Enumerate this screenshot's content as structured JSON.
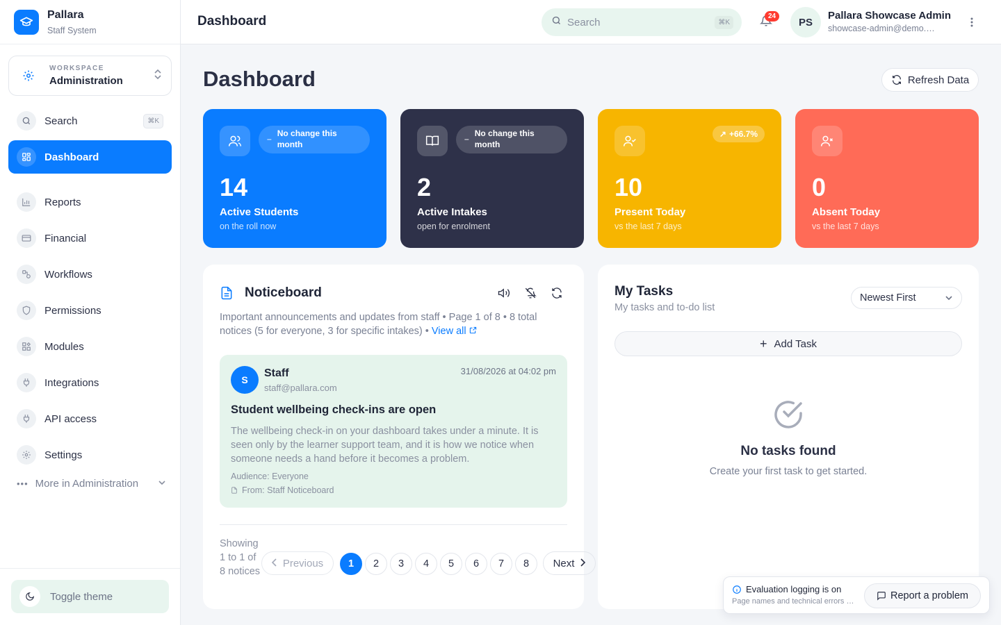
{
  "brand": {
    "name": "Pallara",
    "subtitle": "Staff System",
    "logo_icon": "graduation-cap-icon"
  },
  "workspace": {
    "label": "WORKSPACE",
    "value": "Administration"
  },
  "sidebar": {
    "search_label": "Search",
    "search_shortcut": "⌘K",
    "items": [
      {
        "label": "Dashboard",
        "icon": "grid-icon",
        "active": true
      },
      {
        "label": "Reports",
        "icon": "bar-chart-icon"
      },
      {
        "label": "Financial",
        "icon": "credit-card-icon"
      },
      {
        "label": "Workflows",
        "icon": "workflow-icon"
      },
      {
        "label": "Permissions",
        "icon": "shield-icon"
      },
      {
        "label": "Modules",
        "icon": "modules-icon"
      },
      {
        "label": "Integrations",
        "icon": "plug-icon"
      },
      {
        "label": "API access",
        "icon": "plug-icon"
      },
      {
        "label": "Settings",
        "icon": "gear-icon"
      }
    ],
    "more_label": "More in Administration",
    "toggle_theme": "Toggle theme"
  },
  "topbar": {
    "title": "Dashboard",
    "search_placeholder": "Search",
    "search_shortcut": "⌘K",
    "notifications_count": "24",
    "user": {
      "initials": "PS",
      "name": "Pallara Showcase Admin",
      "email": "showcase-admin@demo.pallara.com"
    }
  },
  "page": {
    "title": "Dashboard",
    "refresh_label": "Refresh Data"
  },
  "stats": [
    {
      "value": "14",
      "label": "Active Students",
      "sub": "on the roll now",
      "pill": "No change this month",
      "color": "#0a7cff",
      "icon": "users-icon"
    },
    {
      "value": "2",
      "label": "Active Intakes",
      "sub": "open for enrolment",
      "pill": "No change this month",
      "color": "#2e3149",
      "icon": "book-icon"
    },
    {
      "value": "10",
      "label": "Present Today",
      "sub": "vs the last 7 days",
      "pill": "+66.7%",
      "color": "#f7b500",
      "icon": "user-check-icon"
    },
    {
      "value": "0",
      "label": "Absent Today",
      "sub": "vs the last 7 days",
      "pill": "",
      "color": "#ff6b57",
      "icon": "user-x-icon"
    }
  ],
  "noticeboard": {
    "title": "Noticeboard",
    "description": "Important announcements and updates from staff • Page 1 of 8 • 8 total notices (5 for everyone, 3 for specific intakes) •",
    "view_all": "View all",
    "notice": {
      "avatar": "S",
      "from": "Staff",
      "email": "staff@pallara.com",
      "date": "31/08/2026 at 04:02 pm",
      "headline": "Student wellbeing check-ins are open",
      "body": "The wellbeing check-in on your dashboard takes under a minute. It is seen only by the learner support team, and it is how we notice when someone needs a hand before it becomes a problem.",
      "audience": "Audience: Everyone",
      "source": "From: Staff Noticeboard"
    },
    "showing": "Showing 1 to 1 of 8 notices",
    "prev_label": "Previous",
    "next_label": "Next",
    "pages": [
      "1",
      "2",
      "3",
      "4",
      "5",
      "6",
      "7",
      "8"
    ],
    "current_page": "1"
  },
  "tasks": {
    "title": "My Tasks",
    "subtitle": "My tasks and to-do list",
    "sort_value": "Newest First",
    "add_label": "Add Task",
    "empty_title": "No tasks found",
    "empty_sub": "Create your first task to get started."
  },
  "toast": {
    "title": "Evaluation logging is on",
    "sub": "Page names and technical errors are recorded",
    "button": "Report a problem"
  }
}
